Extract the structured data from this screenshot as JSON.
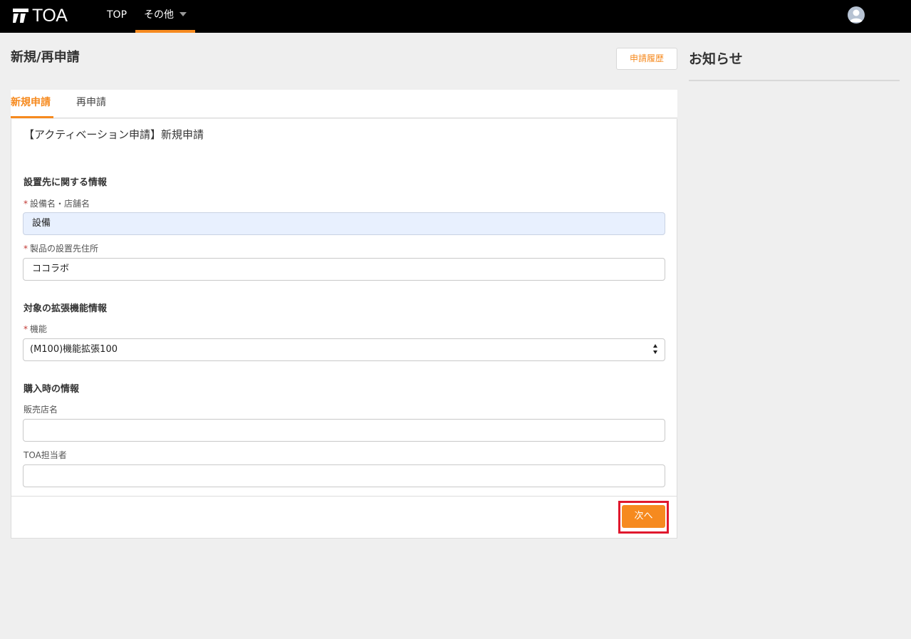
{
  "header": {
    "logo_text": "TOA",
    "nav": {
      "top": "TOP",
      "other": "その他"
    }
  },
  "page": {
    "title": "新規/再申請",
    "history_button": "申請履歴"
  },
  "news": {
    "title": "お知らせ"
  },
  "tabs": {
    "new": "新規申請",
    "reapply": "再申請"
  },
  "form": {
    "heading": "【アクティベーション申請】新規申請",
    "section_location": "設置先に関する情報",
    "facility_label": "設備名・店舗名",
    "facility_value": "設備",
    "address_label": "製品の設置先住所",
    "address_value": "ココラボ",
    "section_feature": "対象の拡張機能情報",
    "feature_label": "機能",
    "feature_value": "(M100)機能拡張100",
    "section_purchase": "購入時の情報",
    "store_label": "販売店名",
    "store_value": "",
    "toa_staff_label": "TOA担当者",
    "toa_staff_value": "",
    "required_mark": "*",
    "next_button": "次へ"
  },
  "colors": {
    "accent": "#f68a1f",
    "highlight": "#e0182d",
    "topbar": "#000000"
  }
}
